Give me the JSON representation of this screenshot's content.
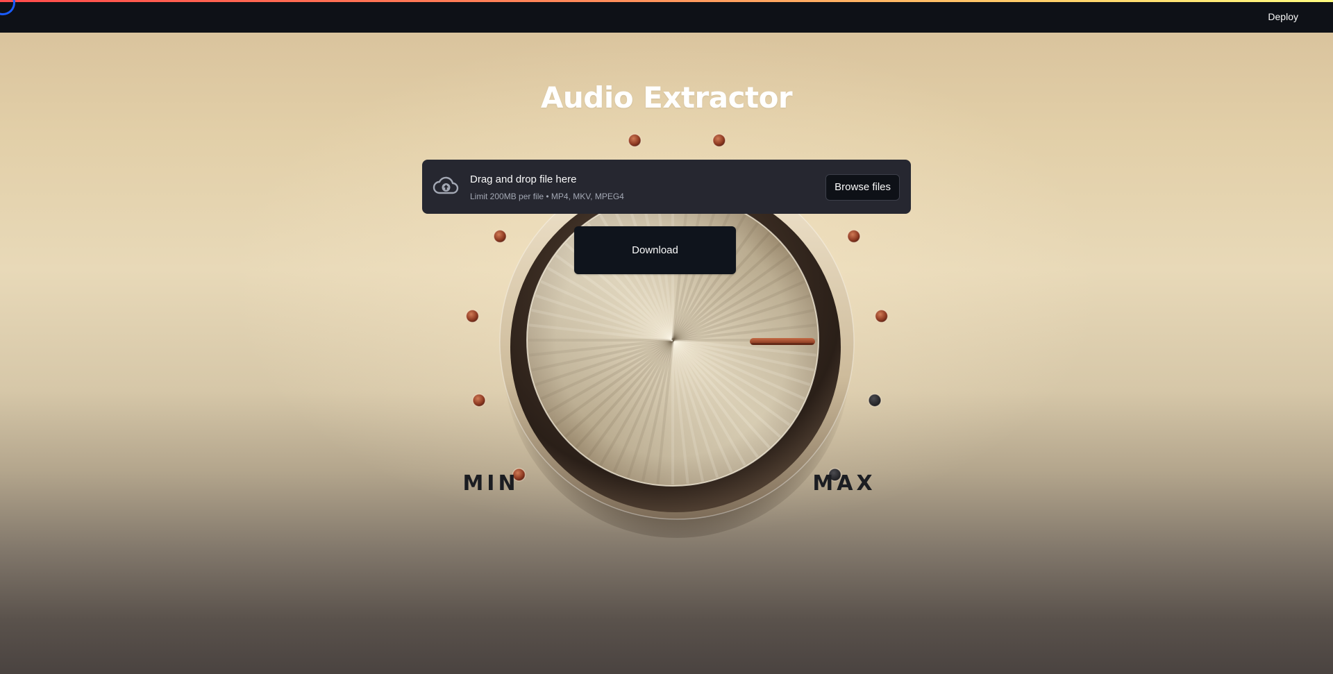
{
  "header": {
    "deploy_label": "Deploy"
  },
  "main": {
    "title": "Audio Extractor"
  },
  "uploader": {
    "drag_text": "Drag and drop file here",
    "limit_text": "Limit 200MB per file • MP4, MKV, MPEG4",
    "browse_label": "Browse files",
    "icon": "cloud-upload-icon"
  },
  "download": {
    "label": "Download"
  },
  "knob": {
    "min_label": "MIN",
    "max_label": "MAX",
    "level_fraction": 0.8,
    "lit_dot_count": 10,
    "total_dot_count": 12
  },
  "colors": {
    "header_bg": "#0e1117",
    "uploader_bg": "#262730",
    "button_bg": "#0e1117",
    "dot_lit": "#a1442a",
    "dot_dark": "#2a2a2c",
    "label_dark": "#1b1d22"
  }
}
